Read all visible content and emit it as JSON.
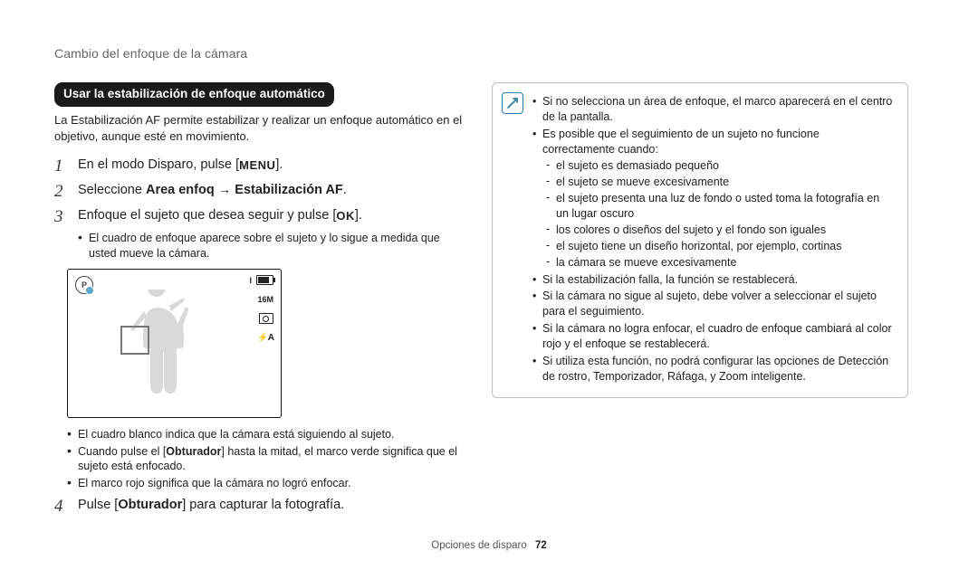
{
  "section_title": "Cambio del enfoque de la cámara",
  "tag": "Usar la estabilización de enfoque automático",
  "intro": "La Estabilización AF permite estabilizar y realizar un enfoque automático en el objetivo, aunque esté en movimiento.",
  "steps": {
    "s1": {
      "num": "1",
      "pre": "En el modo Disparo, pulse [",
      "key": "MENU",
      "post": "]."
    },
    "s2": {
      "num": "2",
      "a": "Seleccione ",
      "b": "Area enfoq",
      "arrow": " → ",
      "c": "Estabilización AF",
      "d": "."
    },
    "s3": {
      "num": "3",
      "pre": "Enfoque el sujeto que desea seguir y pulse [",
      "key": "OK",
      "post": "].",
      "sub": "El cuadro de enfoque aparece sobre el sujeto y lo sigue a medida que usted mueve la cámara."
    },
    "notes": {
      "n1": "El cuadro blanco indica que la cámara está siguiendo al sujeto.",
      "n2a": "Cuando pulse el [",
      "n2b": "Obturador",
      "n2c": "] hasta la mitad, el marco verde significa que el sujeto está enfocado.",
      "n3": "El marco rojo significa que la cámara no logró enfocar."
    },
    "s4": {
      "num": "4",
      "a": "Pulse [",
      "b": "Obturador",
      "c": "] para capturar la fotografía."
    }
  },
  "lcd": {
    "mode_letter": "P",
    "count": "I",
    "size": "16M",
    "flash": "⚡A"
  },
  "info": {
    "i1": "Si no selecciona un área de enfoque, el marco aparecerá en el centro de la pantalla.",
    "i2": "Es posible que el seguimiento de un sujeto no funcione correctamente cuando:",
    "i2a": "el sujeto es demasiado pequeño",
    "i2b": "el sujeto se mueve excesivamente",
    "i2c": "el sujeto presenta una luz de fondo o usted toma la fotografía en un lugar oscuro",
    "i2d": "los colores o diseños del sujeto y el fondo son iguales",
    "i2e": "el sujeto tiene un diseño horizontal, por ejemplo, cortinas",
    "i2f": "la cámara se mueve excesivamente",
    "i3": "Si la estabilización falla, la función se restablecerá.",
    "i4": "Si la cámara no sigue al sujeto, debe volver a seleccionar el sujeto para el seguimiento.",
    "i5": "Si la cámara no logra enfocar, el cuadro de enfoque cambiará al color rojo y el enfoque se restablecerá.",
    "i6": "Si utiliza esta función, no podrá configurar las opciones de Detección de rostro, Temporizador, Ráfaga, y Zoom inteligente."
  },
  "footer": {
    "label": "Opciones de disparo",
    "page": "72"
  }
}
